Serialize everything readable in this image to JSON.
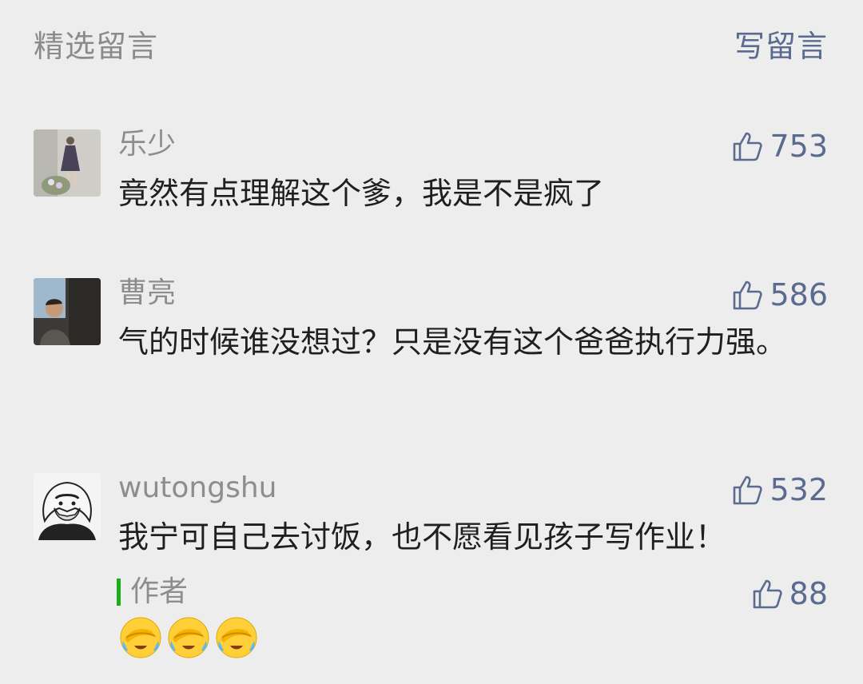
{
  "header": {
    "title": "精选留言",
    "write_label": "写留言"
  },
  "comments": [
    {
      "nickname": "乐少",
      "text": "竟然有点理解这个爹，我是不是疯了",
      "likes": "753"
    },
    {
      "nickname": "曹亮",
      "text": "气的时候谁没想过？只是没有这个爸爸执行力强。",
      "likes": "586"
    },
    {
      "nickname": "wutongshu",
      "text": "我宁可自己去讨饭，也不愿看见孩子写作业！",
      "likes": "532",
      "reply": {
        "author_label": "作者",
        "likes": "88",
        "emoji_count": 3
      }
    }
  ],
  "colors": {
    "accent": "#5b6b90",
    "author_bar": "#1aad19",
    "background": "#ededed"
  },
  "icons": [
    "thumbs-up-icon",
    "face-palm-emoji"
  ]
}
